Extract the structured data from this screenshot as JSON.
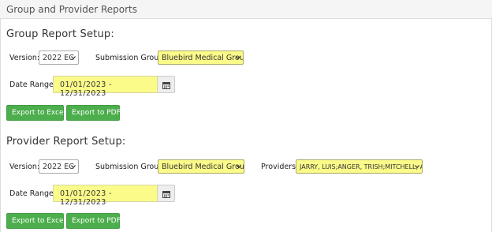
{
  "panel": {
    "title": "Group and Provider Reports"
  },
  "group": {
    "heading": "Group Report Setup:",
    "version_label": "Version:",
    "version_value": "2022 EC",
    "submission_label": "Submission Group:",
    "submission_value": "Bluebird Medical Group",
    "date_label": "Date Range:",
    "date_value": "01/01/2023 - 12/31/2023",
    "export_excel": "Export to Excel",
    "export_pdf": "Export to PDF"
  },
  "provider": {
    "heading": "Provider Report Setup:",
    "version_label": "Version:",
    "version_value": "2022 EC",
    "submission_label": "Submission Group:",
    "submission_value": "Bluebird Medical Group",
    "providers_label": "Providers:",
    "providers_value": "JARRY, LUIS;ANGER, TRISH;MITCHELL, AVRA",
    "date_label": "Date Range:",
    "date_value": "01/01/2023 - 12/31/2023",
    "export_excel": "Export to Excel",
    "export_pdf": "Export to PDF"
  },
  "colors": {
    "highlight": "#fbfb8a",
    "button_green": "#4cae4c",
    "header_bg": "#f5f5f5"
  },
  "icons": {
    "calendar": "calendar-icon",
    "caret": "chevron-down-icon"
  }
}
